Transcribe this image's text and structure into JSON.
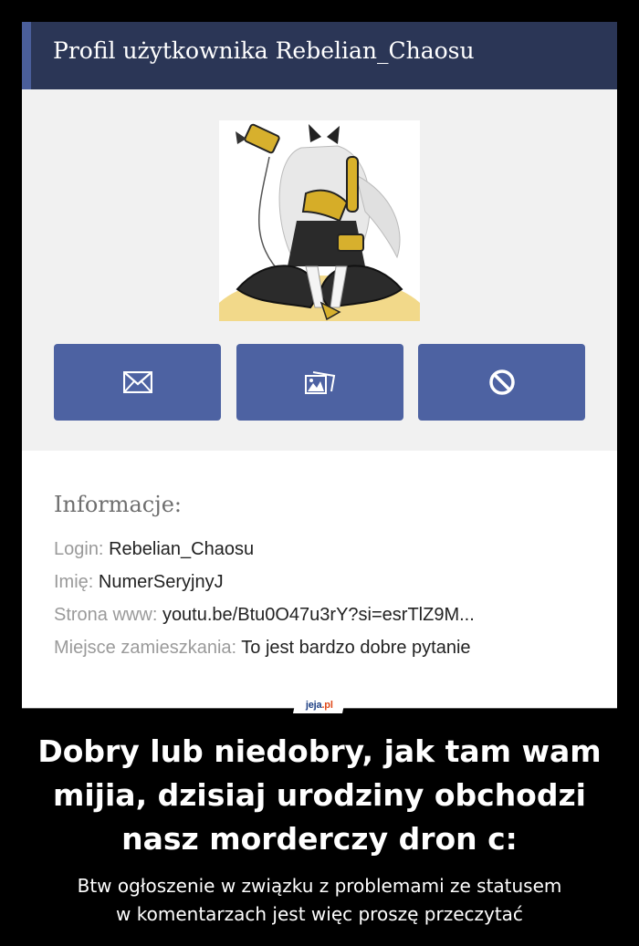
{
  "header": {
    "title": "Profil użytkownika Rebelian_Chaosu"
  },
  "profile": {
    "avatar_icon": "anime-character-avatar",
    "actions": [
      {
        "icon": "envelope-icon"
      },
      {
        "icon": "gallery-icon"
      },
      {
        "icon": "block-icon"
      }
    ]
  },
  "info": {
    "title": "Informacje:",
    "rows": [
      {
        "label": "Login:",
        "value": "Rebelian_Chaosu"
      },
      {
        "label": "Imię:",
        "value": "NumerSeryjnyJ"
      },
      {
        "label": "Strona www:",
        "value": "youtu.be/Btu0O47u3rY?si=esrTlZ9M..."
      },
      {
        "label": "Miejsce zamieszkania:",
        "value": "To jest bardzo dobre pytanie"
      }
    ]
  },
  "watermark": {
    "main": "jeja",
    "suffix": ".pl"
  },
  "caption": {
    "line1": "Dobry lub niedobry, jak tam wam",
    "line2": "mijia, dzisiaj urodziny obchodzi",
    "line3": "nasz morderczy dron c:"
  },
  "subcaption": {
    "line1": "Btw ogłoszenie w związku z problemami ze statusem",
    "line2": "w komentarzach jest więc proszę przeczytać"
  },
  "colors": {
    "header_bg": "#2b3656",
    "header_accent": "#4a5e9a",
    "button_bg": "#4d62a2",
    "panel_bg": "#f1f1f1"
  }
}
